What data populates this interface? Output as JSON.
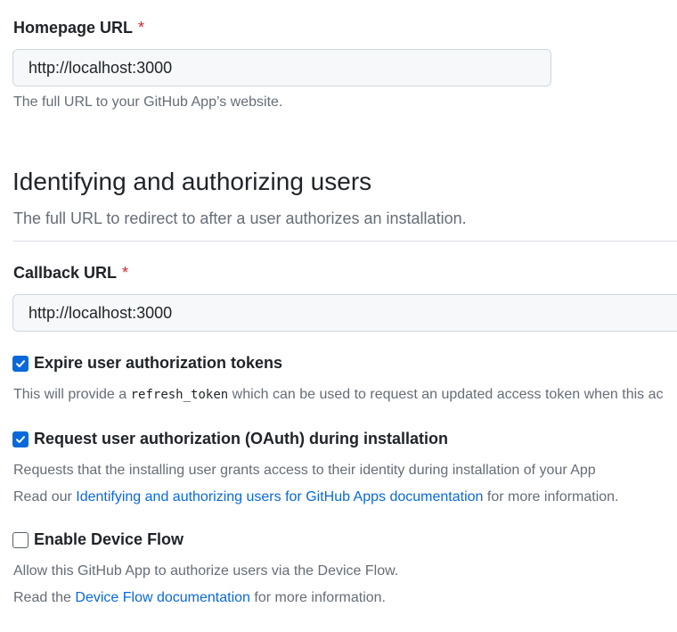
{
  "homepage": {
    "label": "Homepage URL",
    "required_mark": "*",
    "value": "http://localhost:3000",
    "note": "The full URL to your GitHub App’s website."
  },
  "identifying_section": {
    "heading": "Identifying and authorizing users",
    "subheading": "The full URL to redirect to after a user authorizes an installation."
  },
  "callback": {
    "label": "Callback URL",
    "required_mark": "*",
    "value": "http://localhost:3000"
  },
  "expire_tokens": {
    "label": "Expire user authorization tokens",
    "checked": true,
    "note_prefix": "This will provide a ",
    "note_code": "refresh_token",
    "note_suffix": " which can be used to request an updated access token when this ac"
  },
  "request_oauth": {
    "label": "Request user authorization (OAuth) during installation",
    "checked": true,
    "note": "Requests that the installing user grants access to their identity during installation of your App",
    "doc_prefix": "Read our ",
    "doc_link": "Identifying and authorizing users for GitHub Apps documentation",
    "doc_suffix": " for more information."
  },
  "device_flow": {
    "label": "Enable Device Flow",
    "checked": false,
    "note": "Allow this GitHub App to authorize users via the Device Flow.",
    "doc_prefix": "Read the ",
    "doc_link": "Device Flow documentation",
    "doc_suffix": " for more information."
  },
  "colors": {
    "accent": "#0969da",
    "required": "#d1242f",
    "muted_text": "#656d76",
    "input_bg": "#f6f8fa"
  }
}
